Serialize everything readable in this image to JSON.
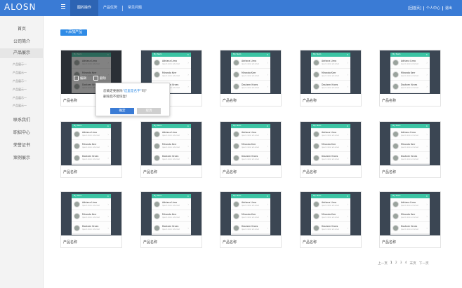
{
  "app": {
    "logo": "ALOSN"
  },
  "nav": {
    "items": [
      {
        "label": "图的操作",
        "active": true
      },
      {
        "label": "产品优势",
        "active": false
      },
      {
        "label": "常见问题",
        "active": false
      }
    ]
  },
  "top_right": {
    "links": [
      "[回首页]",
      "个人中心",
      "退出"
    ]
  },
  "sidebar": {
    "items": [
      {
        "label": "首页"
      },
      {
        "label": "公司简介"
      },
      {
        "label": "产品展示",
        "active": true
      },
      {
        "label": "联系我们"
      },
      {
        "label": "职招中心"
      },
      {
        "label": "荣誉证书"
      },
      {
        "label": "案例展示"
      }
    ],
    "subitems": [
      "产品展示一",
      "产品展示一",
      "产品展示一",
      "产品展示一",
      "产品展示一",
      "产品展示一"
    ]
  },
  "toolbar": {
    "add_label": "+添加产品"
  },
  "product": {
    "card_label": "产品名称",
    "phone_title": "My Team",
    "contacts": [
      {
        "name": "Adriana Lima",
        "sub": "Ipsum dolor sit amet"
      },
      {
        "name": "Miranda Kerr",
        "sub": "Ipsum dolor sit amet"
      },
      {
        "name": "Doutzen Kroes",
        "sub": "Ipsum dolor sit amet"
      }
    ]
  },
  "overlay": {
    "edit_label": "编辑",
    "delete_label": "删除"
  },
  "dialog": {
    "line1_prefix": "您确定要删除",
    "line1_highlight": "\"这里是名字\"",
    "line1_suffix": "吗？",
    "line2": "删除后不能恢复！",
    "ok_label": "确定",
    "cancel_label": "取消"
  },
  "pagination": {
    "prev": "上一页",
    "pages": [
      "1",
      "2",
      "3",
      "4"
    ],
    "current": "1",
    "last": "末页",
    "next": "下一页"
  },
  "colors": {
    "topbar": "#3a7bd5",
    "accent": "#2f8be6",
    "phone_header": "#3cc4a4",
    "card_bg": "#3b4653"
  }
}
